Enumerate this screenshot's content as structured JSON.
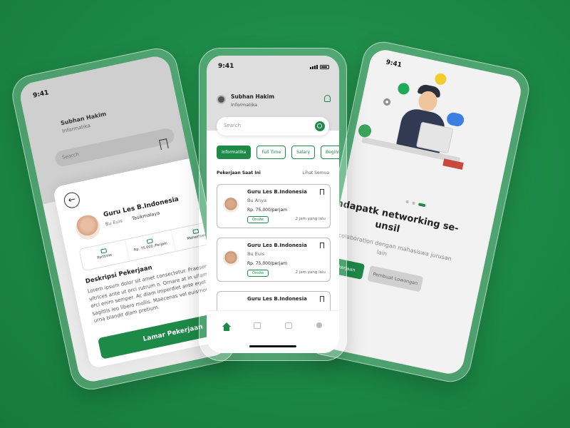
{
  "colors": {
    "background": "#1d8a48",
    "accent": "#1d8a48",
    "card": "#ffffff"
  },
  "left_phone": {
    "status_time": "9:41",
    "user_name": "Subhan Hakim",
    "user_role": "Informatika",
    "search_placeholder": "Search",
    "job_title": "Guru Les B.Indonesia",
    "teacher": "Bu Euis",
    "location": "Tasikmalaya",
    "tiles": [
      "Parttime",
      "Rp. 75.000 /Perjam",
      "Mahasiswa"
    ],
    "description_heading": "Deskripsi Pekerjaan",
    "description": "Lorem ipsum dolor sit amet consectetur. Praesent ultrices ante ut orci rutrum n. Ornare at in ullamcorper orci enim semper. Ac diam imperdiet ante eget semper sagittis leo libero mollis. Maecenas vel euismod vitae elit urna blandit diam pretium.",
    "apply_button": "Lamar Pekerjaan"
  },
  "center_phone": {
    "status_time": "9:41",
    "user_name": "Subhan Hakim",
    "user_role": "Informatika",
    "search_placeholder": "Search",
    "chips": [
      "Informatika",
      "Full Time",
      "Salary",
      "Beginner"
    ],
    "section_title": "Pekerjaan Saat Ini",
    "see_all": "Lihat Semua",
    "jobs": [
      {
        "title": "Guru Les B.Indonesia",
        "teacher": "Bu Anya",
        "price": "Rp. 75,000/perjam",
        "badge": "Onsite",
        "time": "2 jam yang lalu"
      },
      {
        "title": "Guru Les B.Indonesia",
        "teacher": "Bu Euis",
        "price": "Rp. 75,000/perjam",
        "badge": "Onsite",
        "time": "2 jam yang lalu"
      },
      {
        "title": "Guru Les B.Indonesia"
      }
    ],
    "nav_icons": [
      "home-icon",
      "mail-icon",
      "briefcase-icon",
      "user-icon"
    ]
  },
  "right_phone": {
    "status_time": "9:41",
    "title": "Mendapatk networking se-unsil",
    "description": "Bisa bercolaboration dengan mahasiswa jurusan lain",
    "primary_button": "Cari Pekerjaan",
    "secondary_button": "Pembuat Lowongan"
  }
}
